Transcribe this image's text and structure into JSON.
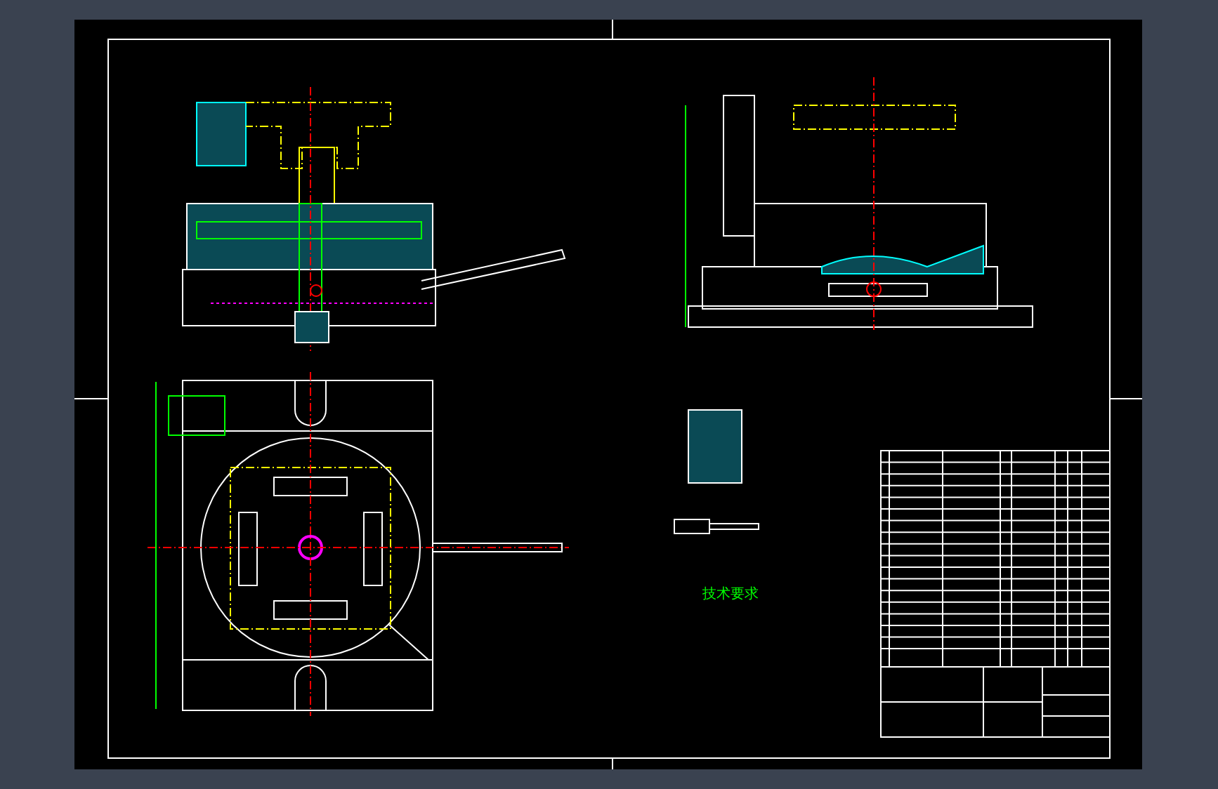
{
  "technical_requirements": {
    "heading": "技术要求"
  }
}
